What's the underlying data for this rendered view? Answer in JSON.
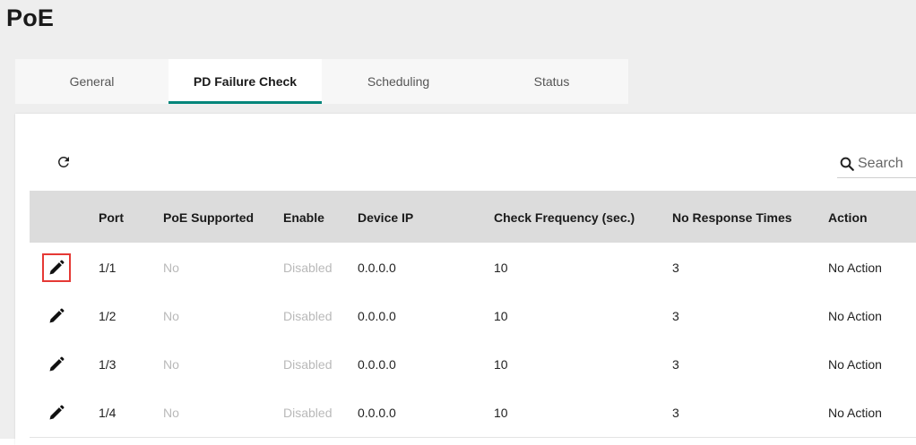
{
  "page": {
    "title": "PoE"
  },
  "tabs": [
    {
      "label": "General",
      "active": false
    },
    {
      "label": "PD Failure Check",
      "active": true
    },
    {
      "label": "Scheduling",
      "active": false
    },
    {
      "label": "Status",
      "active": false
    }
  ],
  "toolbar": {
    "refresh_icon": "refresh-icon",
    "search_icon": "search-icon",
    "search_placeholder": "Search"
  },
  "table": {
    "columns": [
      "",
      "Port",
      "PoE Supported",
      "Enable",
      "Device IP",
      "Check Frequency (sec.)",
      "No Response Times",
      "Action"
    ],
    "rows": [
      {
        "port": "1/1",
        "poe_supported": "No",
        "enable": "Disabled",
        "device_ip": "0.0.0.0",
        "check_frequency": "10",
        "no_response_times": "3",
        "action": "No Action"
      },
      {
        "port": "1/2",
        "poe_supported": "No",
        "enable": "Disabled",
        "device_ip": "0.0.0.0",
        "check_frequency": "10",
        "no_response_times": "3",
        "action": "No Action"
      },
      {
        "port": "1/3",
        "poe_supported": "No",
        "enable": "Disabled",
        "device_ip": "0.0.0.0",
        "check_frequency": "10",
        "no_response_times": "3",
        "action": "No Action"
      },
      {
        "port": "1/4",
        "poe_supported": "No",
        "enable": "Disabled",
        "device_ip": "0.0.0.0",
        "check_frequency": "10",
        "no_response_times": "3",
        "action": "No Action"
      }
    ]
  },
  "colors": {
    "accent": "#00857a",
    "highlight_border": "#e53935",
    "header_bg": "#dcdcdc",
    "muted_text": "#b9b9b9"
  }
}
